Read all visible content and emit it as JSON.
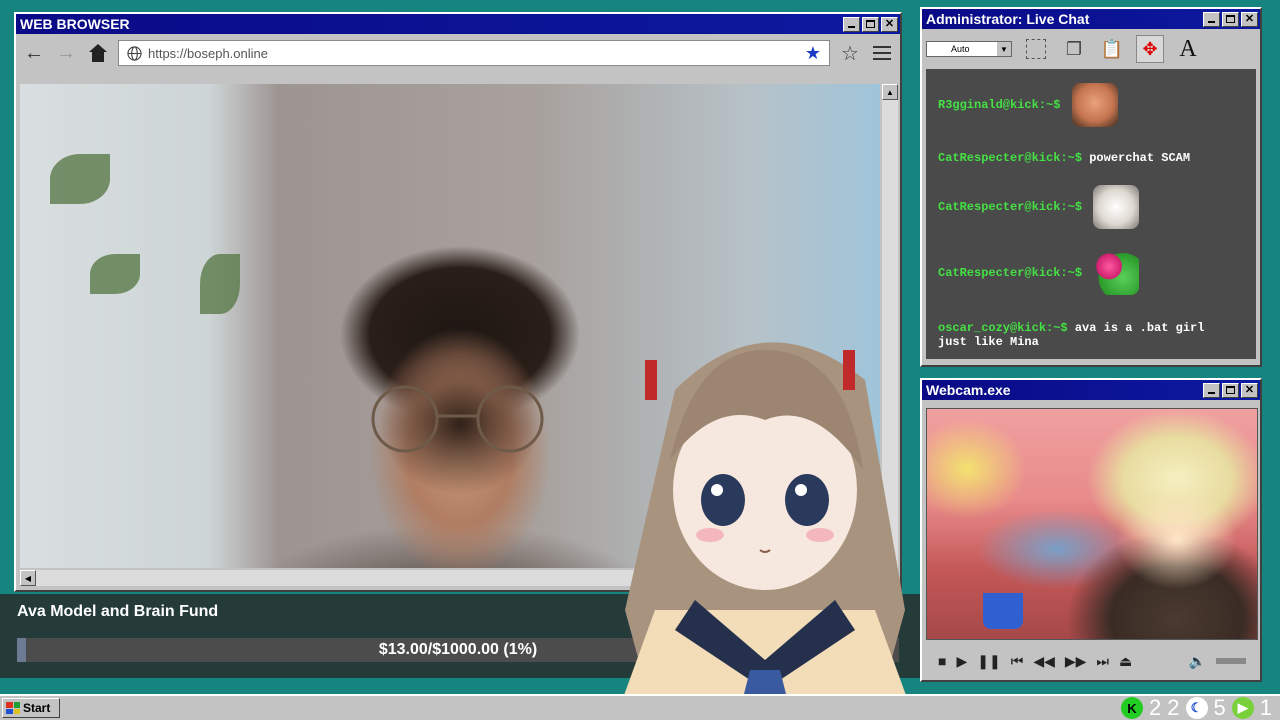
{
  "browser": {
    "title": "WEB BROWSER",
    "url": "https://boseph.online",
    "back_icon": "←",
    "forward_icon": "→",
    "home_icon": "⌂",
    "bookmark_star": "★",
    "star_outline": "☆"
  },
  "fund": {
    "title": "Ava Model and Brain Fund",
    "progress_text": "$13.00/$1000.00 (1%)",
    "progress_fraction": 0.01
  },
  "chat": {
    "title": "Administrator: Live Chat",
    "zoom_select": "Auto",
    "font_tool_label": "A",
    "messages": [
      {
        "user": "R3gginald@kick:~$",
        "text": "",
        "emote": "surprised-face-emote"
      },
      {
        "user": "CatRespecter@kick:~$",
        "text": "powerchat SCAM",
        "emote": ""
      },
      {
        "user": "CatRespecter@kick:~$",
        "text": "",
        "emote": "cat-emote"
      },
      {
        "user": "CatRespecter@kick:~$",
        "text": "",
        "emote": "frog-emote"
      },
      {
        "user": "oscar_cozy@kick:~$",
        "text": "ava is a .bat girl just like Mina",
        "emote": ""
      }
    ]
  },
  "webcam": {
    "title": "Webcam.exe"
  },
  "taskbar": {
    "start_label": "Start",
    "tray_num1": "2",
    "tray_num2": "2",
    "tray_num3": "5",
    "tray_num4": "1",
    "kick_icon_label": "K"
  },
  "colors": {
    "desktop": "#16857f",
    "titlebar": "#0a0a86",
    "chat_user": "#44e044",
    "bookmark_star": "#1a3bc8"
  }
}
